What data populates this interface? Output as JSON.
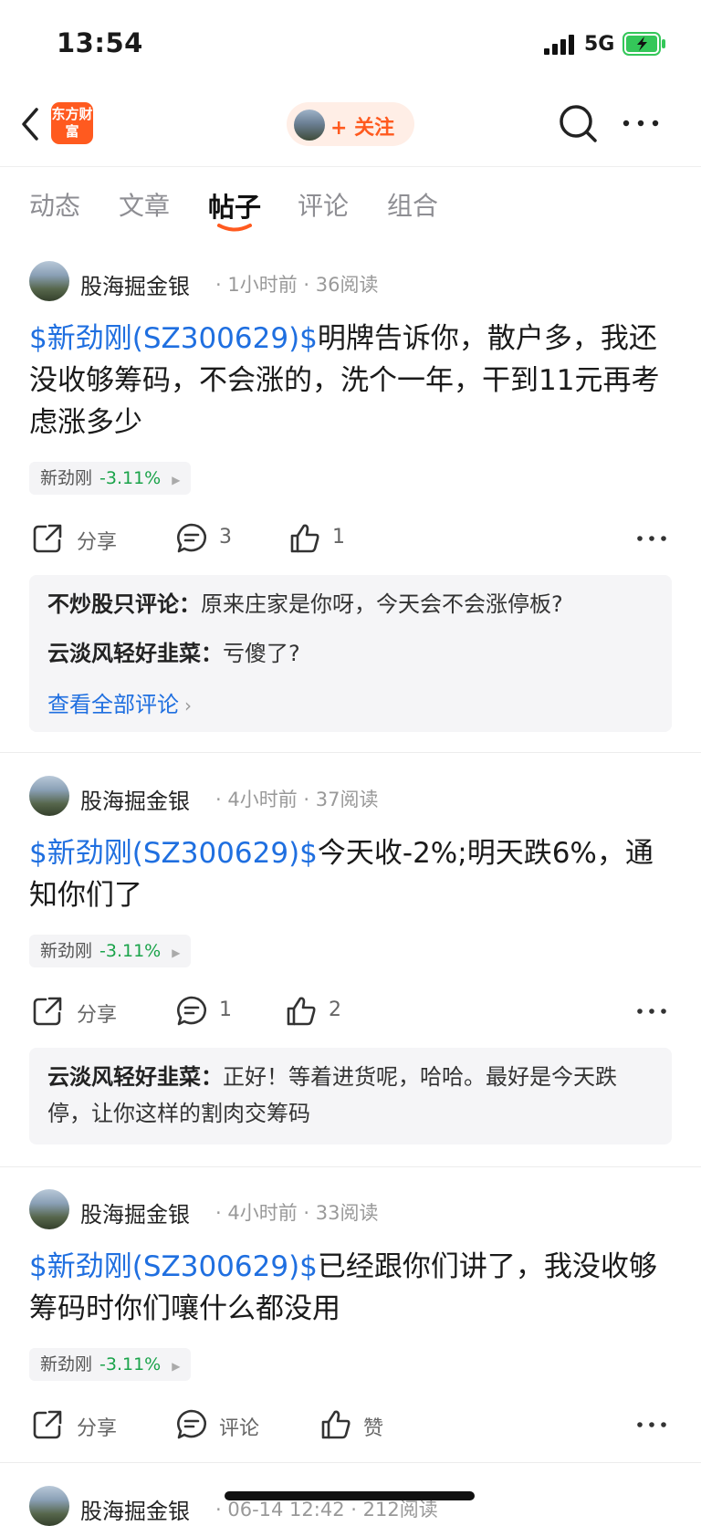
{
  "status_bar": {
    "time": "13:54",
    "network": "5G"
  },
  "nav": {
    "logo_text": "东方财富",
    "follow_label": "+ 关注"
  },
  "tabs": [
    {
      "label": "动态",
      "active": false
    },
    {
      "label": "文章",
      "active": false
    },
    {
      "label": "帖子",
      "active": true
    },
    {
      "label": "评论",
      "active": false
    },
    {
      "label": "组合",
      "active": false
    }
  ],
  "posts": [
    {
      "author": "股海掘金银",
      "time": "1小时前",
      "reads": "36阅读",
      "ticker": "$新劲刚(SZ300629)$",
      "text": "明牌告诉你，散户多，我还没收够筹码，不会涨的，洗个一年，干到11元再考虑涨多少",
      "stock_name": "新劲刚",
      "stock_change": "-3.11%",
      "share_label": "分享",
      "comment_count": "3",
      "like_count": "1",
      "comments": [
        {
          "user": "不炒股只评论",
          "text": "原来庄家是你呀，今天会不会涨停板?"
        },
        {
          "user": "云淡风轻好韭菜",
          "text": "亏傻了?"
        }
      ],
      "view_all": "查看全部评论"
    },
    {
      "author": "股海掘金银",
      "time": "4小时前",
      "reads": "37阅读",
      "ticker": "$新劲刚(SZ300629)$",
      "text": "今天收-2%;明天跌6%，通知你们了",
      "stock_name": "新劲刚",
      "stock_change": "-3.11%",
      "share_label": "分享",
      "comment_count": "1",
      "like_count": "2",
      "comments": [
        {
          "user": "云淡风轻好韭菜",
          "text": "正好！等着进货呢，哈哈。最好是今天跌停，让你这样的割肉交筹码"
        }
      ]
    },
    {
      "author": "股海掘金银",
      "time": "4小时前",
      "reads": "33阅读",
      "ticker": "$新劲刚(SZ300629)$",
      "text": "已经跟你们讲了，我没收够筹码时你们嚷什么都没用",
      "stock_name": "新劲刚",
      "stock_change": "-3.11%",
      "share_label": "分享",
      "comment_label": "评论",
      "like_label": "赞"
    },
    {
      "author": "股海掘金银",
      "time": "06-14 12:42",
      "reads": "212阅读"
    }
  ],
  "colors": {
    "accent": "#ff5a1f",
    "link": "#1f6fe0",
    "down": "#1aa34a"
  }
}
